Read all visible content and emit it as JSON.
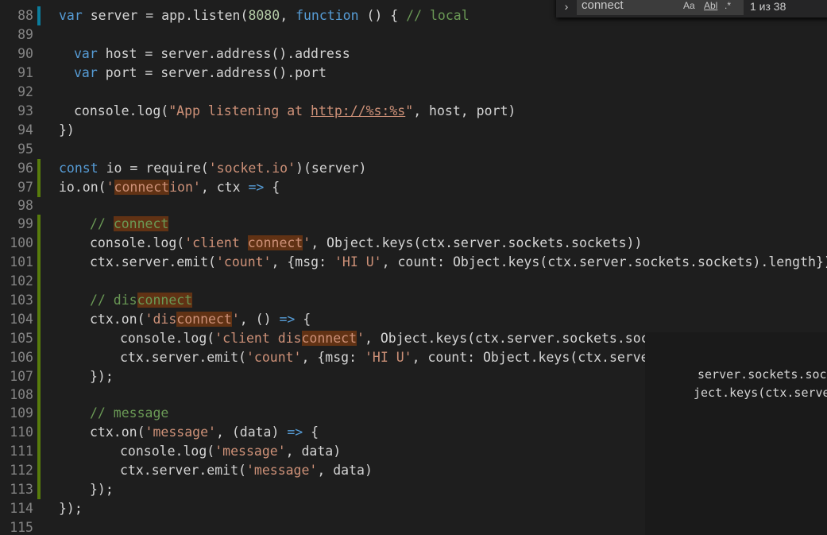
{
  "find": {
    "query": "connect",
    "match_case_label": "Aa",
    "whole_word_label": "Abl",
    "regex_label": ".*",
    "result_count": "1 из 38"
  },
  "code": {
    "lines": [
      {
        "n": "88",
        "git": "modified"
      },
      {
        "n": "89",
        "git": "none"
      },
      {
        "n": "90",
        "git": "none"
      },
      {
        "n": "91",
        "git": "none"
      },
      {
        "n": "92",
        "git": "none"
      },
      {
        "n": "93",
        "git": "none"
      },
      {
        "n": "94",
        "git": "none"
      },
      {
        "n": "95",
        "git": "none"
      },
      {
        "n": "96",
        "git": "added"
      },
      {
        "n": "97",
        "git": "added"
      },
      {
        "n": "98",
        "git": "none"
      },
      {
        "n": "99",
        "git": "added"
      },
      {
        "n": "100",
        "git": "added"
      },
      {
        "n": "101",
        "git": "added"
      },
      {
        "n": "102",
        "git": "added"
      },
      {
        "n": "103",
        "git": "added"
      },
      {
        "n": "104",
        "git": "added"
      },
      {
        "n": "105",
        "git": "added"
      },
      {
        "n": "106",
        "git": "added"
      },
      {
        "n": "107",
        "git": "added"
      },
      {
        "n": "108",
        "git": "added"
      },
      {
        "n": "109",
        "git": "added"
      },
      {
        "n": "110",
        "git": "added"
      },
      {
        "n": "111",
        "git": "added"
      },
      {
        "n": "112",
        "git": "added"
      },
      {
        "n": "113",
        "git": "added"
      },
      {
        "n": "114",
        "git": "none"
      },
      {
        "n": "115",
        "git": "none"
      }
    ],
    "t88a": "var",
    "t88b": " server = app.listen(",
    "t88c": "8080",
    "t88d": ", ",
    "t88e": "function",
    "t88f": " () { ",
    "t88g": "// local",
    "t90a": "var",
    "t90b": " host = server.address().address",
    "t91a": "var",
    "t91b": " port = server.address().port",
    "t93a": "console.log(",
    "t93b": "\"App listening at ",
    "t93c": "http://%s:%s",
    "t93d": "\"",
    "t93e": ", host, port)",
    "t94": "})",
    "t96a": "const",
    "t96b": " io = require(",
    "t96c": "'socket.io'",
    "t96d": ")(server)",
    "t97a": "io.on(",
    "t97b": "'",
    "t97c": "connect",
    "t97d": "ion'",
    "t97e": ", ctx ",
    "t97f": "=>",
    "t97g": " {",
    "t99a": "// ",
    "t99b": "connect",
    "t100a": "console.log(",
    "t100b": "'client ",
    "t100c": "connect",
    "t100d": "'",
    "t100e": ", Object.keys(ctx.server.sockets.sockets))",
    "t101a": "ctx.server.emit(",
    "t101b": "'count'",
    "t101c": ", {msg: ",
    "t101d": "'HI U'",
    "t101e": ", count: Object.keys(ctx.server.sockets.sockets).length})",
    "t103a": "// dis",
    "t103b": "connect",
    "t104a": "ctx.on(",
    "t104b": "'dis",
    "t104c": "connect",
    "t104d": "'",
    "t104e": ", () ",
    "t104f": "=>",
    "t104g": " {",
    "t105a": "console.log(",
    "t105b": "'client dis",
    "t105c": "connect",
    "t105d": "'",
    "t105e": ", Object.keys(ctx.server.sockets.sockets))",
    "t106a": "ctx.server.emit(",
    "t106b": "'count'",
    "t106c": ", {msg: ",
    "t106d": "'HI U'",
    "t106e": ", count: Object.keys(ctx.server.",
    "t107": "});",
    "t109": "// message",
    "t110a": "ctx.on(",
    "t110b": "'message'",
    "t110c": ", (data) ",
    "t110d": "=>",
    "t110e": " {",
    "t111a": "console.log(",
    "t111b": "'message'",
    "t111c": ", data)",
    "t112a": "ctx.server.emit(",
    "t112b": "'message'",
    "t112c": ", data)",
    "t113": "});",
    "t114": "});"
  },
  "overlay": {
    "line1": "server.sockets.socke",
    "line2": "ject.keys(ctx.server"
  },
  "colors": {
    "background": "#1e1e1e",
    "keyword": "#569cd6",
    "string": "#ce9178",
    "number": "#b5cea8",
    "comment": "#6a9955",
    "match_highlight": "#613214",
    "git_added": "#587c0c",
    "git_modified": "#0c7d9d"
  }
}
